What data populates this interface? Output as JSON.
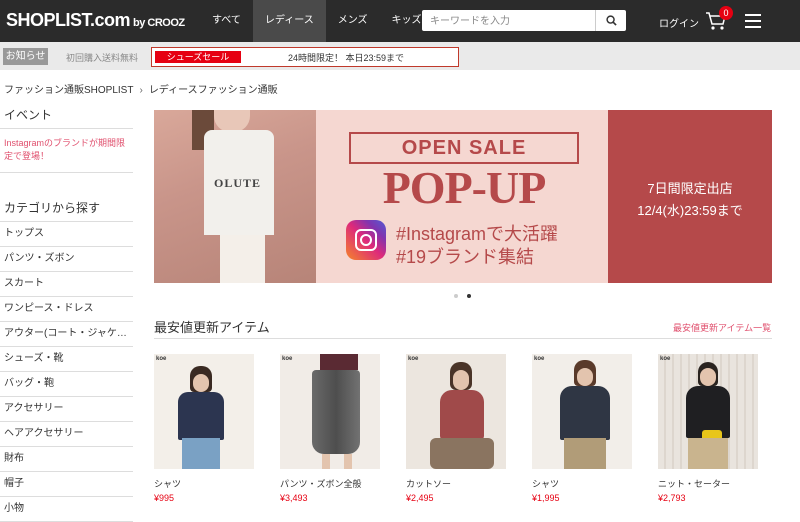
{
  "header": {
    "logo_main": "SHOPLIST.com",
    "logo_by": "by CROOZ",
    "nav": [
      "すべて",
      "レディース",
      "メンズ",
      "キッズ"
    ],
    "nav_active_index": 1,
    "search_placeholder": "キーワードを入力",
    "login": "ログイン",
    "cart_count": "0"
  },
  "notice": {
    "tag": "お知らせ",
    "free_shipping": "初回購入送料無料",
    "sale_tag": "シューズセール",
    "sale_text": "24時間限定！ 本日23:59まで"
  },
  "breadcrumb": [
    "ファッション通販SHOPLIST",
    "レディースファッション通販"
  ],
  "sidebar": {
    "event_heading": "イベント",
    "event_link": "Instagramのブランドが期間限定で登場！",
    "category_heading": "カテゴリから探す",
    "categories": [
      "トップス",
      "パンツ・ズボン",
      "スカート",
      "ワンピース・ドレス",
      "アウター(コート・ジャケット)",
      "シューズ・靴",
      "バッグ・鞄",
      "アクセサリー",
      "ヘアアクセサリー",
      "財布",
      "帽子",
      "小物"
    ]
  },
  "banner": {
    "shirt_text": "OLUTE",
    "open_sale": "OPEN SALE",
    "popup": "POP-UP",
    "tag1": "#Instagramで大活躍",
    "tag2": "#19ブランド集結",
    "right1": "7日間限定出店",
    "right2": "12/4(水)23:59まで",
    "slide_count": 2,
    "active_slide": 1
  },
  "section": {
    "title": "最安値更新アイテム",
    "link": "最安値更新アイテム一覧",
    "products": [
      {
        "brand": "koe",
        "name": "シャツ",
        "price": "¥995"
      },
      {
        "brand": "koe",
        "name": "パンツ・ズボン全般",
        "price": "¥3,493"
      },
      {
        "brand": "koe",
        "name": "カットソー",
        "price": "¥2,495"
      },
      {
        "brand": "koe",
        "name": "シャツ",
        "price": "¥1,995"
      },
      {
        "brand": "koe",
        "name": "ニット・セーター",
        "price": "¥2,793"
      }
    ]
  },
  "colors": {
    "header_bg": "#2b2b2b",
    "accent_red": "#e60012",
    "banner_rose": "#b5494a",
    "banner_pink": "#f5d7d1",
    "link_pink": "#e0506e"
  }
}
